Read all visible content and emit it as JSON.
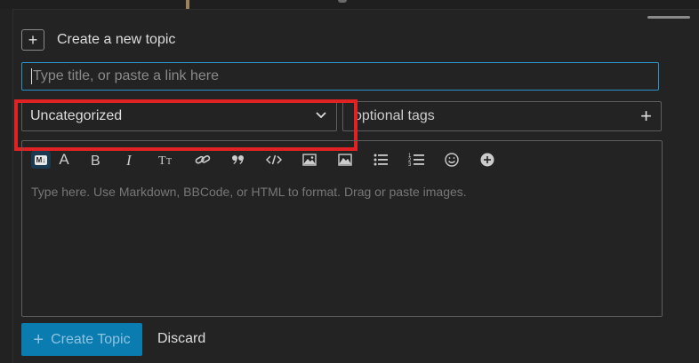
{
  "composer": {
    "header_title": "Create a new topic",
    "title_placeholder": "Type title, or paste a link here",
    "category_value": "Uncategorized",
    "tags_placeholder": "optional tags",
    "editor_placeholder": "Type here. Use Markdown, BBCode, or HTML to format. Drag or paste images.",
    "create_label": "Create Topic",
    "discard_label": "Discard",
    "markdown_badge": "M↓",
    "font_a": "A"
  },
  "toolbar_icons": [
    "markdown-mode-icon",
    "rich-text-icon",
    "bold-icon",
    "italic-icon",
    "heading-icon",
    "link-icon",
    "blockquote-icon",
    "code-icon",
    "image-icon",
    "upload-icon",
    "bullet-list-icon",
    "numbered-list-icon",
    "emoji-icon",
    "more-options-icon"
  ],
  "colors": {
    "accent": "#0a7cb0",
    "focus_border": "#2d93c6",
    "highlight": "#e02222",
    "background": "#232323"
  }
}
